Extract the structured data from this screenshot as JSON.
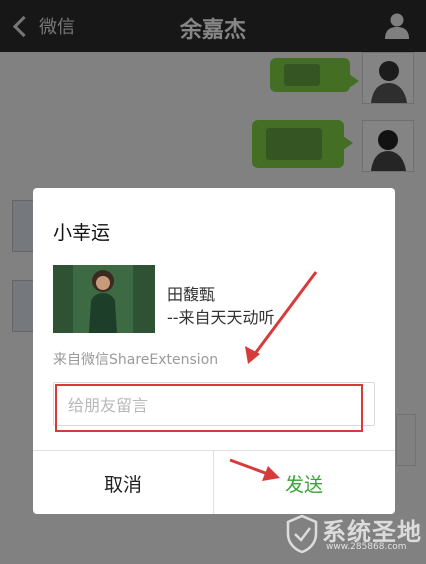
{
  "navbar": {
    "back_label": "微信",
    "title": "余嘉杰",
    "profile_icon": "person-icon"
  },
  "dialog": {
    "title": "小幸运",
    "song_title": "田馥甄",
    "song_sub": "--来自天天动听",
    "source": "来自微信ShareExtension",
    "message_placeholder": "给朋友留言",
    "cancel_label": "取消",
    "send_label": "发送"
  },
  "watermark": {
    "name": "系统圣地",
    "url": "www.285868.com"
  },
  "colors": {
    "navbar": "#2b2b2b",
    "bubble": "#7ac843",
    "send": "#3aa43a",
    "annotation": "#d63a3a"
  }
}
